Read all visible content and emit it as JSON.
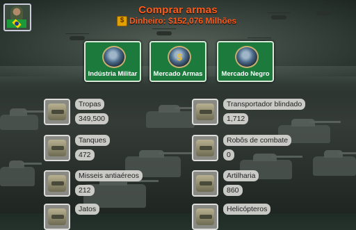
{
  "header": {
    "title": "Comprar armas",
    "money_label": "Dinheiro: $152,076 Milhões",
    "money_icon": "money-icon",
    "country_flag": "brazil-flag-icon",
    "title_color": "#ff5a1a"
  },
  "menu": {
    "items": [
      {
        "label": "Indústria Militar",
        "icon": "tank-icon"
      },
      {
        "label": "Mercado Armas",
        "icon": "money-market-icon"
      },
      {
        "label": "Mercado Negro",
        "icon": "black-market-icon"
      }
    ],
    "button_color": "#1b7a3c"
  },
  "units": {
    "left": [
      {
        "name": "Tropas",
        "count": "349,500",
        "icon": "troops-icon"
      },
      {
        "name": "Tanques",
        "count": "472",
        "icon": "tanks-icon"
      },
      {
        "name": "Misseis antiaéreos",
        "count": "212",
        "icon": "antiaircraft-missiles-icon"
      },
      {
        "name": "Jatos",
        "count": "",
        "icon": "jets-icon"
      }
    ],
    "right": [
      {
        "name": "Transportador blindado",
        "count": "1,712",
        "icon": "armored-carrier-icon"
      },
      {
        "name": "Robôs de combate",
        "count": "0",
        "icon": "combat-robots-icon"
      },
      {
        "name": "Artilharia",
        "count": "860",
        "icon": "artillery-icon"
      },
      {
        "name": "Helicópteros",
        "count": "",
        "icon": "helicopters-icon"
      }
    ]
  }
}
